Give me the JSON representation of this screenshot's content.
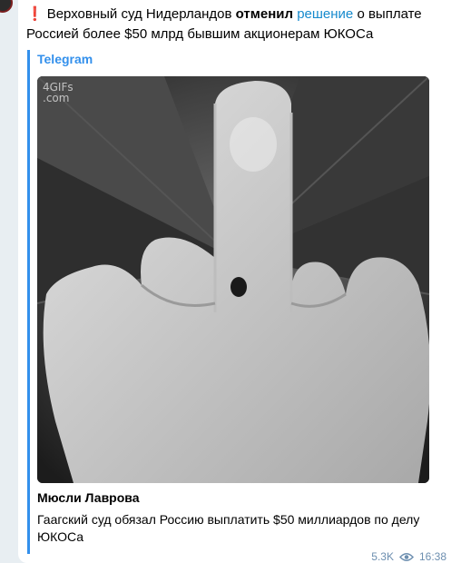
{
  "message": {
    "emoji": "❗",
    "text_part1": "Верховный суд Нидерландов ",
    "text_bold": "отменил",
    "text_part2": " ",
    "link_text": "решение",
    "text_part3": " о выплате Россией более $50 млрд бывшим акционерам ЮКОСа"
  },
  "preview": {
    "site_name": "Telegram",
    "media": {
      "watermark_line1": "4GIFs",
      "watermark_line2": ".com",
      "subject": "middle-finger-hand-gesture"
    },
    "title": "Мюсли Лаврова",
    "description": "Гаагский суд обязал Россию выплатить $50 миллиардов по делу ЮКОСа"
  },
  "footer": {
    "views": "5.3K",
    "views_icon": "eye-icon",
    "time": "16:38"
  },
  "colors": {
    "accent": "#3390ec",
    "link": "#168acd",
    "alert": "#e0202a",
    "meta": "#6d8fb0"
  }
}
